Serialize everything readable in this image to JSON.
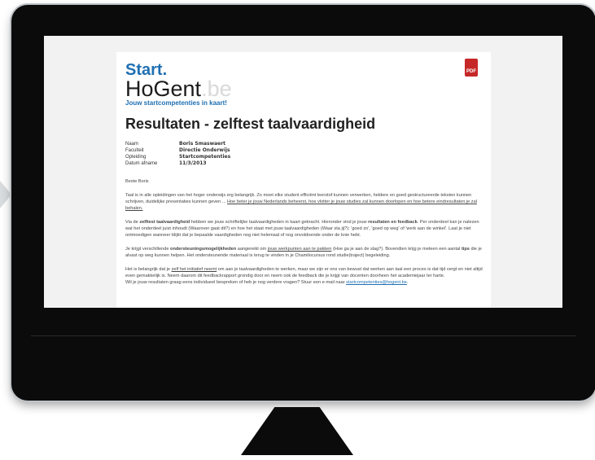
{
  "logo": {
    "start": "Start.",
    "hogent": "HoGent",
    "be": ".be",
    "slogan": "Jouw startcompetenties in kaart!"
  },
  "pdf_label": "PDF",
  "title": "Resultaten - zelftest taalvaardigheid",
  "meta": [
    {
      "k": "Naam",
      "v": "Boris Smaswaert"
    },
    {
      "k": "Faculteit",
      "v": "Directie Onderwijs"
    },
    {
      "k": "Opleiding",
      "v": "Startcompetenties"
    },
    {
      "k": "Datum afname",
      "v": "11/3/2013"
    }
  ],
  "body": {
    "greeting": "Beste Boris",
    "p1a": "Taal is in alle opleidingen van het hoger onderwijs erg belangrijk. Zo moet elke student efficiënt leerstof kunnen verwerken, heldere en goed gestructureerde teksten kunnen schrijven, duidelijke presentaties kunnen geven ... ",
    "p1link": "Hoe beter je jouw Nederlands beheerst, hoe vlotter je jouw studies zal kunnen doorlopen en hoe betere eindresultaten je zal behalen.",
    "p2a": "Via de ",
    "p2b": "zelftest taalvaardigheid",
    "p2c": " hebben we jouw schriftelijke taalvaardigheden in kaart gebracht. Hieronder vind je jouw ",
    "p2d": "resultaten en feedback",
    "p2e": ". Per onderdeel kan je nalezen wat het onderdeel juist inhoudt (Waarover gaat dit?) en hoe het staat met jouw taalvaardigheden (Waar sta jij?): 'goed zo', 'goed op weg' of 'werk aan de winkel'. Laat je niet ontmoedigen wanneer blijkt dat je bepaalde vaardigheden nog niet helemaal of nog onvoldoende onder de knie hebt.",
    "p3a": "Je krijgt verschillende ",
    "p3b": "ondersteuningsmogelijkheden",
    "p3c": " aangereikt om ",
    "p3d": "jouw werkpunten aan te pakken",
    "p3e": " (Hoe ga je aan de slag?). Bovendien krijg je meteen een aantal ",
    "p3f": "tips",
    "p3g": " die je alvast op weg kunnen helpen. Het ondersteunende materiaal is terug te vinden in je Chamilocursus rond studie(traject) begeleiding.",
    "p4a": "Het is belangrijk dat je ",
    "p4b": "zelf het initiatief neemt",
    "p4c": " om aan je taalvaardigheden te werken, maar we zijn er ons van bewust dat werken aan taal een proces is dat tijd vergt en niet altijd even gemakkelijk is. Neem daarom dit feedbackrapport grondig door en neem ook de feedback die je krijgt van docenten doorheen het academiejaar ter harte.",
    "p4d": "Wil je jouw resultaten graag eens individueel bespreken of heb je nog verdere vragen? Stuur een e-mail naar ",
    "p4link": "startcompetenties@hogent.be",
    "p4end": "."
  }
}
